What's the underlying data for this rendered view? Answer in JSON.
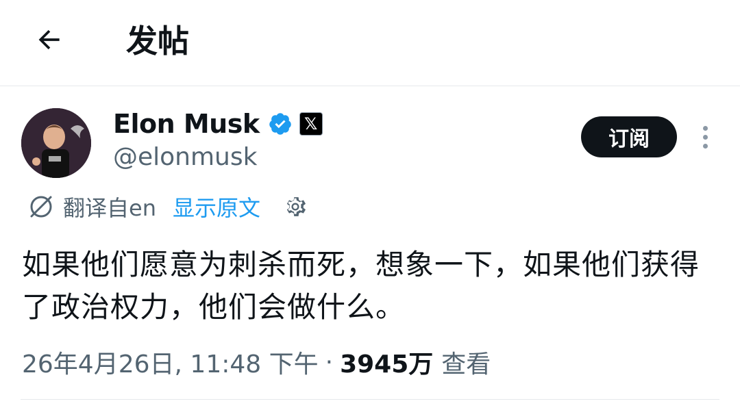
{
  "header": {
    "title": "发帖",
    "back_icon": "arrow-left-icon"
  },
  "author": {
    "name": "Elon Musk",
    "handle": "@elonmusk",
    "verified_icon": "verified-badge-icon",
    "affiliate_label": "𝕏",
    "avatar_icon": "avatar-image"
  },
  "actions": {
    "subscribe_label": "订阅",
    "more_icon": "more-vertical-icon"
  },
  "translation": {
    "label": "翻译自en",
    "show_original": "显示原文",
    "translate_icon": "translate-icon",
    "settings_icon": "gear-icon"
  },
  "post": {
    "text": "如果他们愿意为刺杀而死，想象一下，如果他们获得了政治权力，他们会做什么。"
  },
  "meta": {
    "datetime": "26年4月26日, 11:48 下午",
    "separator": "·",
    "views_count": "3945万",
    "views_label": "查看"
  },
  "colors": {
    "text_primary": "#0f1419",
    "text_secondary": "#536471",
    "link": "#1d9bf0",
    "verified": "#1d9bf0",
    "button_bg": "#0f1419",
    "divider": "#e6e9ec"
  }
}
